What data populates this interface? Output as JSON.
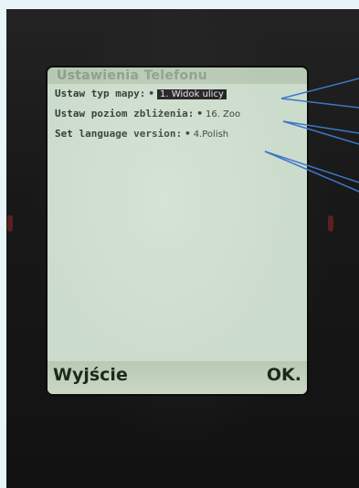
{
  "screen": {
    "title": "Ustawienia Telefonu",
    "settings": [
      {
        "label": "Ustaw typ mapy:",
        "value": "1. Widok ulicy",
        "selected": true
      },
      {
        "label": "Ustaw poziom zbliżenia:",
        "value": "16. Zoo",
        "selected": false
      },
      {
        "label": "Set language version:",
        "value": "4.Polish",
        "selected": false
      }
    ],
    "bullet": "•",
    "softkeys": {
      "left": "Wyjście",
      "right": "OK."
    }
  },
  "colors": {
    "screen_bg": "#ccdccc",
    "title_text": "#8aa08a",
    "callout_line": "#3c78c8"
  }
}
